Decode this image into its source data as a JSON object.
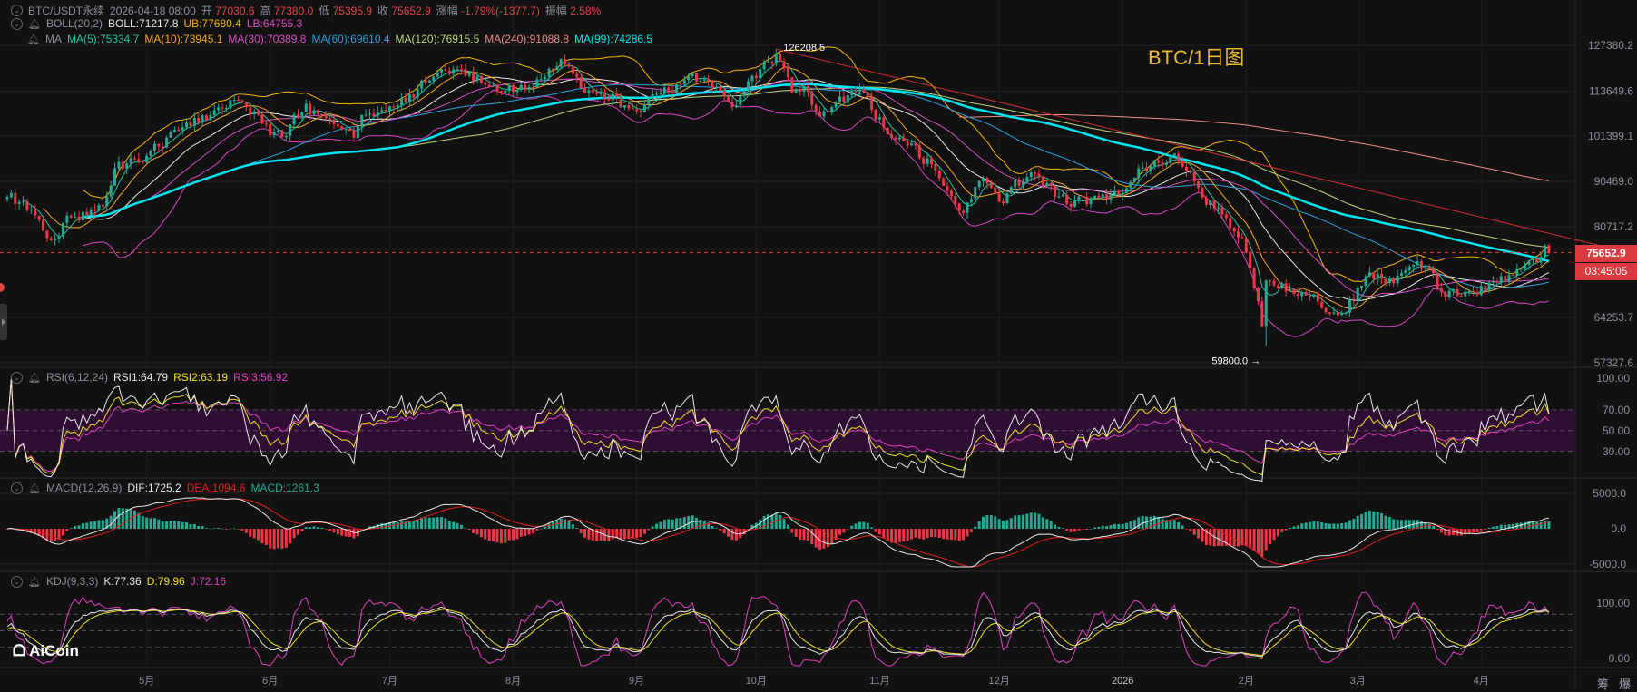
{
  "header": {
    "symbol": "BTC/USDT永续",
    "datetime": "2026-04-18 08:00",
    "open_label": "开",
    "open": "77030.6",
    "high_label": "高",
    "high": "77380.0",
    "low_label": "低",
    "low": "75395.9",
    "close_label": "收",
    "close": "75652.9",
    "change_label": "涨幅",
    "change": "-1.79%(-1377.7)",
    "amplitude_label": "振幅",
    "amplitude": "2.58%"
  },
  "boll": {
    "label": "BOLL(20,2)",
    "mid": "BOLL:71217.8",
    "ub": "UB:77680.4",
    "lb": "LB:64755.3"
  },
  "ma": {
    "label": "MA",
    "items": [
      {
        "text": "MA(5):75334.7",
        "color": "#27c3a0"
      },
      {
        "text": "MA(10):73945.1",
        "color": "#f5a623"
      },
      {
        "text": "MA(30):70389.8",
        "color": "#d94fc4"
      },
      {
        "text": "MA(60):69610.4",
        "color": "#2b9fd9"
      },
      {
        "text": "MA(120):76915.5",
        "color": "#b9d67a"
      },
      {
        "text": "MA(240):91088.8",
        "color": "#f08c8c"
      },
      {
        "text": "MA(99):74286.5",
        "color": "#00e5f0"
      }
    ]
  },
  "rsi": {
    "label": "RSI(6,12,24)",
    "r1": "RSI1:64.79",
    "r2": "RSI2:63.19",
    "r3": "RSI3:56.92"
  },
  "macd": {
    "label": "MACD(12,26,9)",
    "dif": "DIF:1725.2",
    "dea": "DEA:1094.6",
    "macd": "MACD:1261.3"
  },
  "kdj": {
    "label": "KDJ(9,3,3)",
    "k": "K:77.36",
    "d": "D:79.96",
    "j": "J:72.16"
  },
  "chart_title": "BTC/1日图",
  "current_price": "75652.9",
  "countdown": "03:45:05",
  "logo": "AiCoin",
  "footer": {
    "chips": "筹",
    "liquidation": "爆"
  },
  "colors": {
    "up": "#22ab94",
    "down": "#f23645",
    "accent": "#e7b731"
  },
  "chart_data": {
    "type": "candlestick",
    "title": "BTC/1日图",
    "start_date": "2025-03-27",
    "end_date": "2026-04-18",
    "last_candle": {
      "open": 77030.6,
      "high": 77380.0,
      "low": 75395.9,
      "close": 75652.9
    },
    "annotations": [
      {
        "label": "126208.5",
        "date": "2025-10-06",
        "value": 126208.5,
        "kind": "high"
      },
      {
        "label": "59800.0",
        "date": "2026-02-06",
        "value": 59800.0,
        "kind": "low"
      }
    ],
    "anchor_closes": [
      [
        "2025-03-27",
        87000
      ],
      [
        "2025-04-03",
        83000
      ],
      [
        "2025-04-07",
        78000
      ],
      [
        "2025-04-10",
        81500
      ],
      [
        "2025-04-20",
        85000
      ],
      [
        "2025-04-23",
        93500
      ],
      [
        "2025-05-01",
        96500
      ],
      [
        "2025-05-08",
        103000
      ],
      [
        "2025-05-12",
        104000
      ],
      [
        "2025-05-22",
        111000
      ],
      [
        "2025-05-31",
        104500
      ],
      [
        "2025-06-05",
        101500
      ],
      [
        "2025-06-10",
        110000
      ],
      [
        "2025-06-17",
        104500
      ],
      [
        "2025-06-22",
        101000
      ],
      [
        "2025-06-25",
        107000
      ],
      [
        "2025-07-03",
        109500
      ],
      [
        "2025-07-10",
        116000
      ],
      [
        "2025-07-14",
        120000
      ],
      [
        "2025-07-20",
        118000
      ],
      [
        "2025-08-01",
        113300
      ],
      [
        "2025-08-08",
        117000
      ],
      [
        "2025-08-13",
        123000
      ],
      [
        "2025-08-19",
        113000
      ],
      [
        "2025-08-25",
        111000
      ],
      [
        "2025-09-01",
        108000
      ],
      [
        "2025-09-12",
        115500
      ],
      [
        "2025-09-18",
        117000
      ],
      [
        "2025-09-25",
        109000
      ],
      [
        "2025-10-02",
        120000
      ],
      [
        "2025-10-06",
        124500
      ],
      [
        "2025-10-10",
        113000
      ],
      [
        "2025-10-13",
        115000
      ],
      [
        "2025-10-17",
        106500
      ],
      [
        "2025-10-27",
        114000
      ],
      [
        "2025-11-04",
        101000
      ],
      [
        "2025-11-14",
        94500
      ],
      [
        "2025-11-21",
        84000
      ],
      [
        "2025-11-26",
        90500
      ],
      [
        "2025-12-01",
        86000
      ],
      [
        "2025-12-09",
        92500
      ],
      [
        "2025-12-18",
        85500
      ],
      [
        "2025-12-31",
        87500
      ],
      [
        "2026-01-05",
        93500
      ],
      [
        "2026-01-14",
        97000
      ],
      [
        "2026-01-20",
        89000
      ],
      [
        "2026-01-31",
        78500
      ],
      [
        "2026-02-05",
        62900
      ],
      [
        "2026-02-06",
        70500
      ],
      [
        "2026-02-15",
        68500
      ],
      [
        "2026-02-25",
        65000
      ],
      [
        "2026-03-04",
        72000
      ],
      [
        "2026-03-10",
        70000
      ],
      [
        "2026-03-16",
        74000
      ],
      [
        "2026-03-22",
        68500
      ],
      [
        "2026-03-31",
        68000
      ],
      [
        "2026-04-08",
        71500
      ],
      [
        "2026-04-14",
        74500
      ],
      [
        "2026-04-17",
        77030.6
      ],
      [
        "2026-04-18",
        75652.9
      ]
    ],
    "price_axis": {
      "scale": "log",
      "ticks": [
        "127380.2",
        "113649.6",
        "101399.1",
        "90469.0",
        "80717.2",
        "64253.7",
        "57327.6"
      ]
    },
    "rsi_axis": {
      "ticks": [
        "100.00",
        "70.00",
        "50.00",
        "30.00"
      ]
    },
    "macd_axis": {
      "ticks": [
        "5000.0",
        "0.0",
        "-5000.0"
      ]
    },
    "kdj_axis": {
      "ticks": [
        "100.00",
        "0.00"
      ]
    },
    "x_axis": [
      {
        "label": "5月",
        "date": "2025-05-01"
      },
      {
        "label": "6月",
        "date": "2025-06-01"
      },
      {
        "label": "7月",
        "date": "2025-07-01"
      },
      {
        "label": "8月",
        "date": "2025-08-01"
      },
      {
        "label": "9月",
        "date": "2025-09-01"
      },
      {
        "label": "10月",
        "date": "2025-10-01"
      },
      {
        "label": "11月",
        "date": "2025-11-01"
      },
      {
        "label": "12月",
        "date": "2025-12-01"
      },
      {
        "label": "2026",
        "date": "2026-01-01"
      },
      {
        "label": "2月",
        "date": "2026-02-01"
      },
      {
        "label": "3月",
        "date": "2026-03-01"
      },
      {
        "label": "4月",
        "date": "2026-04-01"
      }
    ],
    "indicators": [
      "MA5",
      "MA10",
      "MA30",
      "MA60",
      "MA99",
      "MA120",
      "MA240",
      "BOLL(20,2)",
      "RSI(6,12,24)",
      "MACD(12,26,9)",
      "KDJ(9,3,3)"
    ]
  }
}
